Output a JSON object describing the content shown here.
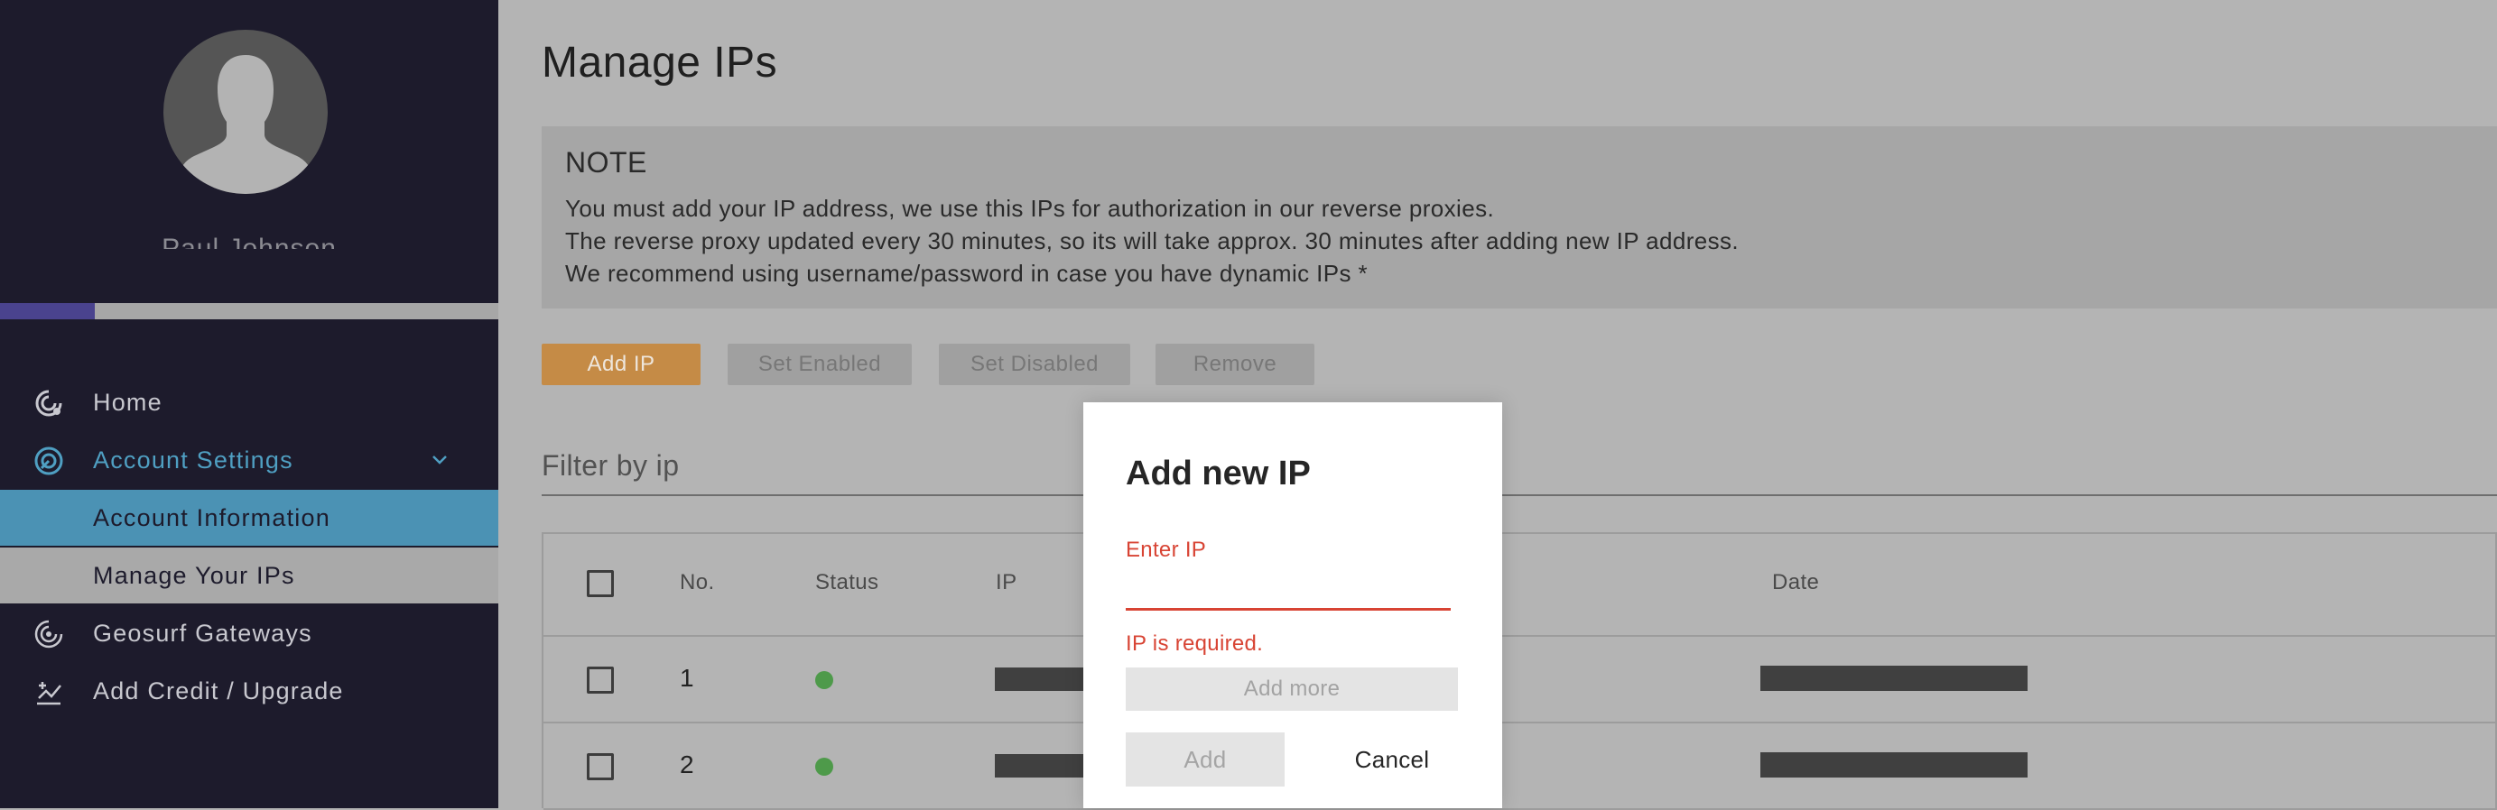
{
  "sidebar": {
    "username": "Paul Johnson",
    "progress": 0.19,
    "colors": {
      "background": "#1d1b2c",
      "progress_fill": "#4a438e",
      "accent": "#4f9fc2",
      "selected_bg": "#4b92b4"
    },
    "items": [
      {
        "label": "Home",
        "icon": "home-gauge-icon"
      },
      {
        "label": "Account Settings",
        "icon": "settings-dial-icon",
        "expanded": true
      },
      {
        "label": "Account Information"
      },
      {
        "label": "Manage Your IPs"
      },
      {
        "label": "Geosurf Gateways",
        "icon": "gateway-icon"
      },
      {
        "label": "Add Credit / Upgrade",
        "icon": "upgrade-chart-icon"
      }
    ]
  },
  "main": {
    "title": "Manage IPs",
    "note": {
      "title": "NOTE",
      "lines": [
        "You must add your IP address, we use this IPs for authorization in our reverse proxies.",
        "The reverse proxy updated every 30 minutes, so its will take approx. 30 minutes after adding new IP address.",
        "We recommend using username/password in case you have dynamic IPs *"
      ]
    },
    "toolbar": {
      "add_ip": "Add IP",
      "set_enabled": "Set Enabled",
      "set_disabled": "Set Disabled",
      "remove": "Remove",
      "accent_color": "#c58b46"
    },
    "filter": {
      "label": "Filter by ip"
    },
    "table": {
      "headers": {
        "no": "No.",
        "status": "Status",
        "ip": "IP",
        "date": "Date"
      },
      "rows": [
        {
          "no": "1",
          "status": "enabled",
          "status_color": "#4e9a4a"
        },
        {
          "no": "2",
          "status": "enabled",
          "status_color": "#4e9a4a"
        }
      ]
    }
  },
  "dialog": {
    "title": "Add new IP",
    "ip_label": "Enter IP",
    "ip_value": "",
    "error": "IP is required.",
    "add_more": "Add more",
    "add": "Add",
    "cancel": "Cancel",
    "error_color": "#d84434"
  }
}
